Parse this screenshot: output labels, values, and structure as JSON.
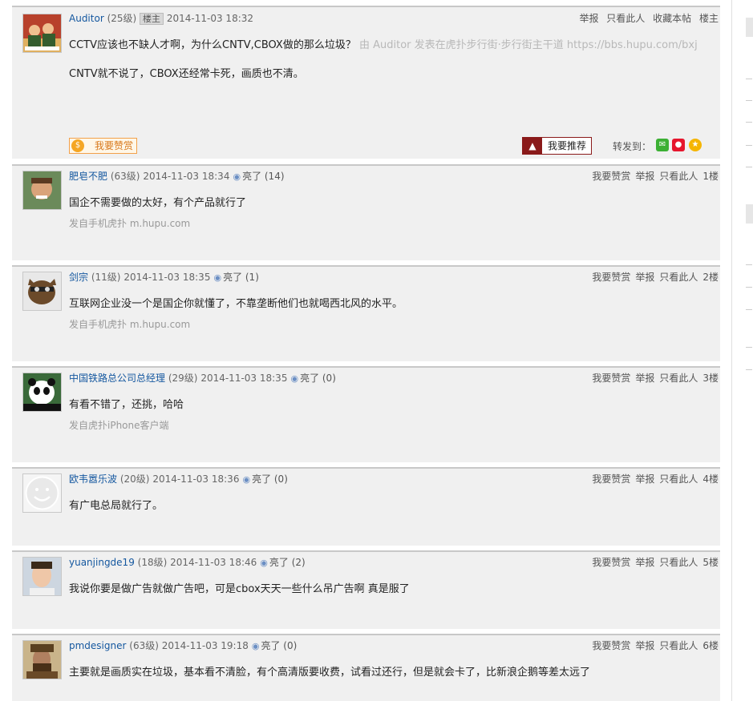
{
  "op": {
    "user": "Auditor",
    "level": "(25级)",
    "owner_badge": "楼主",
    "time": "2014-11-03 18:32",
    "actions": [
      "举报",
      "只看此人",
      "收藏本帖",
      "楼主"
    ],
    "title_line": "CCTV应该也不缺人才啊，为什么CNTV,CBOX做的那么垃圾？",
    "from_note": "由 Auditor 发表在虎扑步行街·步行街主干道 https://bbs.hupu.com/bxj",
    "body": "CNTV就不说了，CBOX还经常卡死，画质也不清。",
    "reward_label": "我要赞赏",
    "recommend_label": "我要推荐",
    "share_label": "转发到："
  },
  "replies": [
    {
      "user": "肥皂不肥",
      "level": "(63级)",
      "time": "2014-11-03 18:34",
      "light": "亮了 (14)",
      "floor": "1楼",
      "text": "国企不需要做的太好，有个产品就行了",
      "source": "发自手机虎扑 m.hupu.com"
    },
    {
      "user": "剑宗",
      "level": "(11级)",
      "time": "2014-11-03 18:35",
      "light": "亮了 (1)",
      "floor": "2楼",
      "text": "互联网企业没一个是国企你就懂了，不靠垄断他们也就喝西北风的水平。",
      "source": "发自手机虎扑 m.hupu.com"
    },
    {
      "user": "中国铁路总公司总经理",
      "level": "(29级)",
      "time": "2014-11-03 18:35",
      "light": "亮了 (0)",
      "floor": "3楼",
      "text": "有看不错了，还挑，哈哈",
      "source": "发自虎扑iPhone客户端"
    },
    {
      "user": "欧韦嚣乐波",
      "level": "(20级)",
      "time": "2014-11-03 18:36",
      "light": "亮了 (0)",
      "floor": "4楼",
      "text": "有广电总局就行了。",
      "source": ""
    },
    {
      "user": "yuanjingde19",
      "level": "(18级)",
      "time": "2014-11-03 18:46",
      "light": "亮了 (2)",
      "floor": "5楼",
      "text": "我说你要是做广告就做广告吧，可是cbox天天一些什么吊广告啊 真是服了",
      "source": ""
    },
    {
      "user": "pmdesigner",
      "level": "(63级)",
      "time": "2014-11-03 19:18",
      "light": "亮了 (0)",
      "floor": "6楼",
      "text": "主要就是画质实在垃圾，基本看不清脸，有个高清版要收费，试看过还行，但是就会卡了，比新浪企鹅等差太远了",
      "source": ""
    }
  ],
  "reply_actions": [
    "我要赞赏",
    "举报",
    "只看此人"
  ],
  "colors": {
    "username": "#14579f",
    "post_bg": "#f0f0f0",
    "reward": "#f5a623",
    "recommend": "#8a1a1a"
  }
}
